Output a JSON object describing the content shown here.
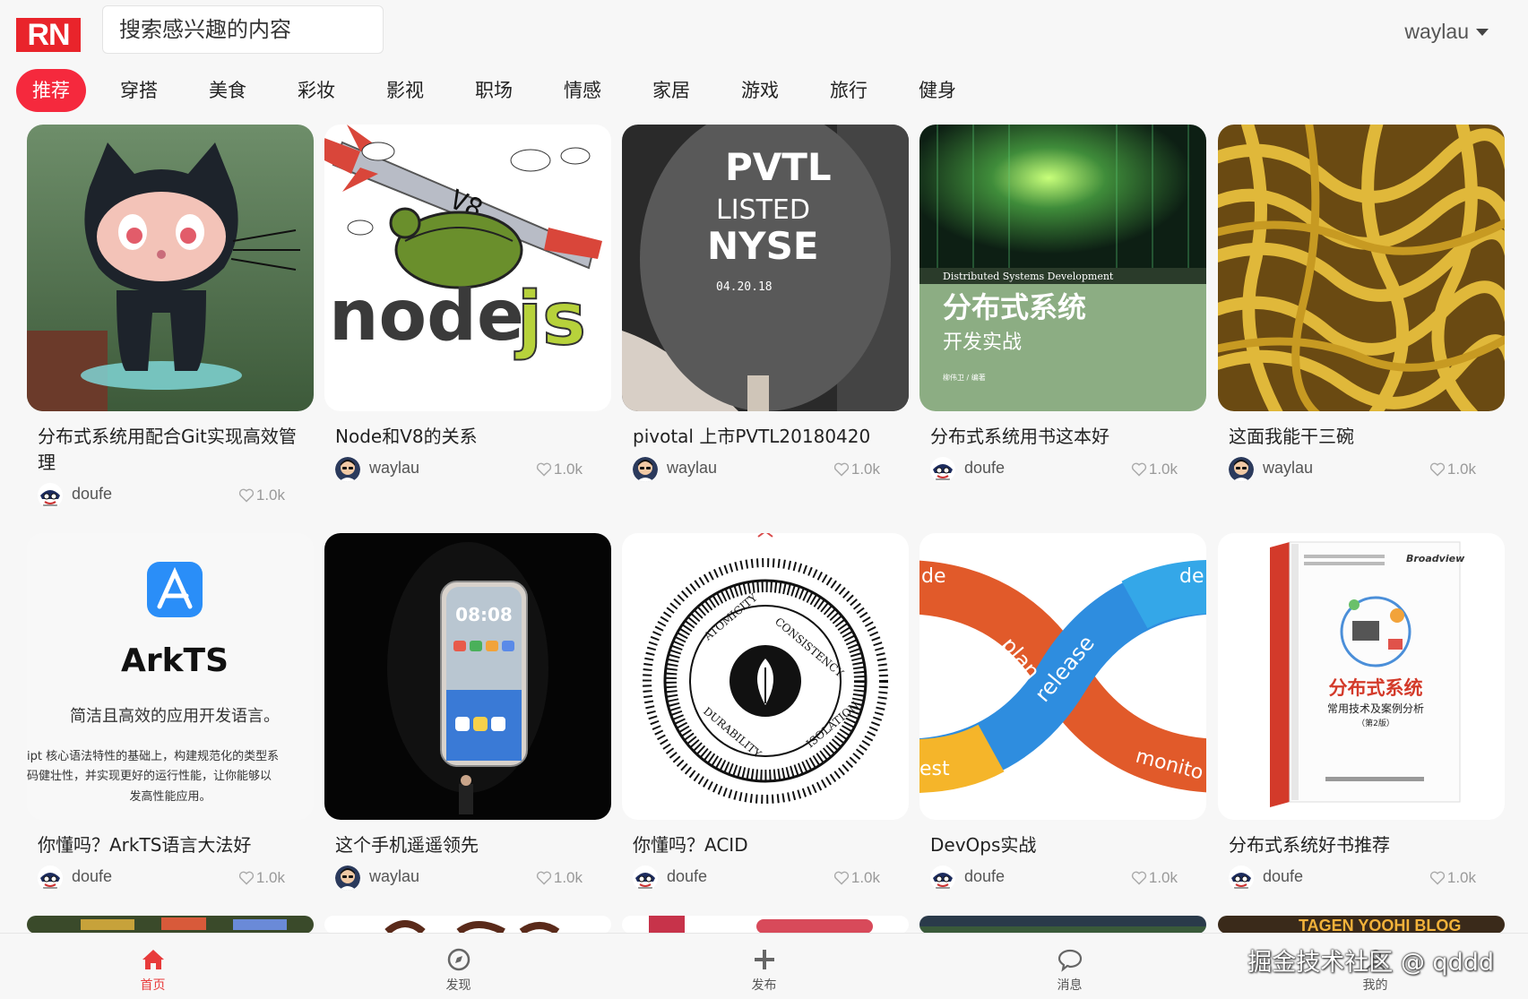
{
  "header": {
    "logo_text": "RN",
    "search_placeholder": "搜索感兴趣的内容",
    "username": "waylau"
  },
  "tabs": [
    "推荐",
    "穿搭",
    "美食",
    "彩妆",
    "影视",
    "职场",
    "情感",
    "家居",
    "游戏",
    "旅行",
    "健身"
  ],
  "active_tab": "推荐",
  "cards": [
    {
      "title": "分布式系统用配合Git实现高效管理",
      "author": "doufe",
      "likes": "1.0k",
      "image": "github-octocat-figurine"
    },
    {
      "title": "Node和V8的关系",
      "author": "waylau",
      "likes": "1.0k",
      "image": "nodejs-turtle-rocket"
    },
    {
      "title": "pivotal 上市PVTL20180420",
      "author": "waylau",
      "likes": "1.0k",
      "image": "pvtl-listed-nyse-paddle"
    },
    {
      "title": "分布式系统用书这本好",
      "author": "doufe",
      "likes": "1.0k",
      "image": "distributed-systems-book-cover"
    },
    {
      "title": "这面我能干三碗",
      "author": "waylau",
      "likes": "1.0k",
      "image": "noodles-photo"
    },
    {
      "title": "你懂吗？ArkTS语言大法好",
      "author": "doufe",
      "likes": "1.0k",
      "image": "arkts-logo-card"
    },
    {
      "title": "这个手机遥遥领先",
      "author": "waylau",
      "likes": "1.0k",
      "image": "phone-keynote-stage"
    },
    {
      "title": "你懂吗？ACID",
      "author": "doufe",
      "likes": "1.0k",
      "image": "acid-seal-badge"
    },
    {
      "title": "DevOps实战",
      "author": "doufe",
      "likes": "1.0k",
      "image": "devops-infinity-loop"
    },
    {
      "title": "分布式系统好书推荐",
      "author": "doufe",
      "likes": "1.0k",
      "image": "distributed-book-3d"
    }
  ],
  "card_images": {
    "book_en": "Distributed Systems Development",
    "book_title": "分布式系统",
    "book_sub": "开发实战",
    "book_author": "柳伟卫 / 编著",
    "arkts_name": "ArkTS",
    "arkts_slogan": "简洁且高效的应用开发语言。",
    "arkts_desc1": "ipt 核心语法特性的基础上，构建规范化的类型系",
    "arkts_desc2": "码健壮性，并实现更好的运行性能，让你能够以",
    "arkts_desc3": "发高性能应用。",
    "phone_time": "08:08",
    "pvtl1": "PVTL",
    "pvtl2": "LISTED",
    "pvtl3": "NYSE",
    "pvtl4": "04.20.18",
    "book2_title": "分布式系统",
    "book2_sub": "常用技术及案例分析",
    "book2_ed": "（第2版）",
    "book2_brand": "Broadview",
    "node_text": "node",
    "js_text": "js",
    "v8_text": "V8"
  },
  "bottom_tabs": [
    {
      "label": "首页",
      "icon": "home-icon",
      "active": true
    },
    {
      "label": "发现",
      "icon": "compass-icon",
      "active": false
    },
    {
      "label": "发布",
      "icon": "plus-icon",
      "active": false
    },
    {
      "label": "消息",
      "icon": "chat-bubble-icon",
      "active": false
    },
    {
      "label": "我的",
      "icon": "user-icon",
      "active": false
    }
  ],
  "watermark": "掘金技术社区 @ qddd",
  "colors": {
    "accent": "#f5293d",
    "home_active": "#e83b3b"
  }
}
